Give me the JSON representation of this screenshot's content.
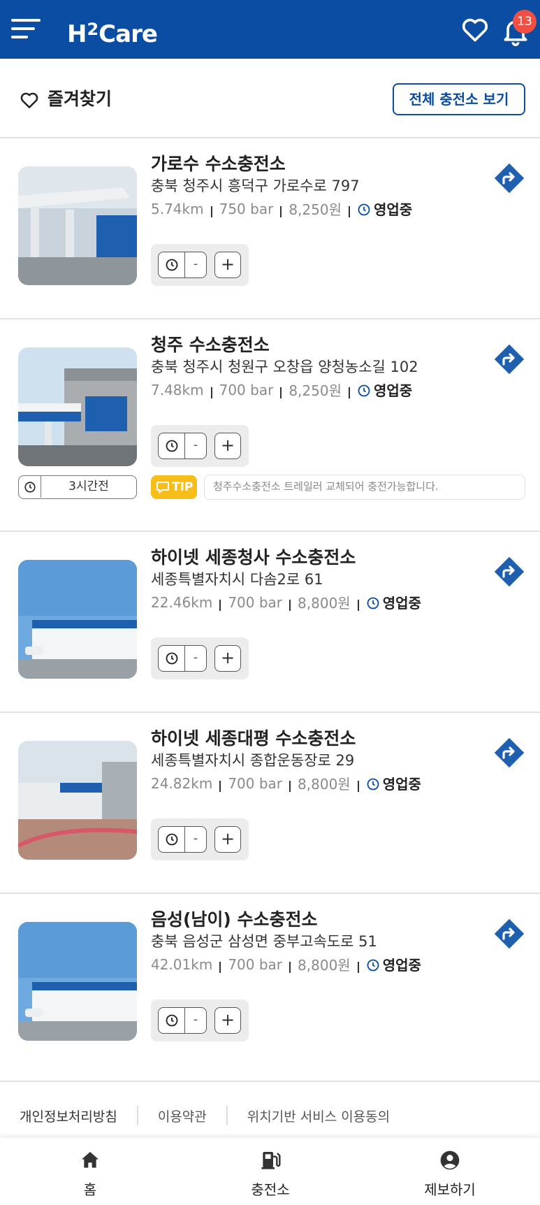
{
  "header": {
    "logo_text": "H2Care",
    "notification_count": "13",
    "brand_color": "#0b4da2"
  },
  "favorites": {
    "title": "즐겨찾기",
    "view_all_label": "전체 충전소 보기"
  },
  "stations": [
    {
      "name": "가로수 수소충전소",
      "address": "충북 청주시 흥덕구 가로수로 797",
      "distance": "5.74km",
      "pressure": "750 bar",
      "price": "8,250원",
      "status": "영업중",
      "stepper_value": "-"
    },
    {
      "name": "청주 수소충전소",
      "address": "충북 청주시 청원구 오창읍 양청농소길 102",
      "distance": "7.48km",
      "pressure": "700 bar",
      "price": "8,250원",
      "status": "영업중",
      "stepper_value": "-",
      "updated": "3시간전",
      "tip_label": "TIP",
      "tip_text": "청주수소충전소 트레일러 교체되어 충전가능합니다."
    },
    {
      "name": "하이넷 세종청사 수소충전소",
      "address": "세종특별자치시 다솜2로 61",
      "distance": "22.46km",
      "pressure": "700 bar",
      "price": "8,800원",
      "status": "영업중",
      "stepper_value": "-"
    },
    {
      "name": "하이넷 세종대평 수소충전소",
      "address": "세종특별자치시 종합운동장로 29",
      "distance": "24.82km",
      "pressure": "700 bar",
      "price": "8,800원",
      "status": "영업중",
      "stepper_value": "-"
    },
    {
      "name": "음성(남이) 수소충전소",
      "address": "충북 음성군 삼성면 중부고속도로 51",
      "distance": "42.01km",
      "pressure": "700 bar",
      "price": "8,800원",
      "status": "영업중",
      "stepper_value": "-"
    }
  ],
  "footer": {
    "privacy": "개인정보처리방침",
    "terms": "이용약관",
    "location": "위치기반 서비스 이용동의"
  },
  "bottom_nav": {
    "home": "홈",
    "stations": "충전소",
    "report": "제보하기"
  },
  "icons": [
    "menu-icon",
    "heart-icon",
    "bell-icon",
    "directions-icon",
    "clock-icon",
    "plus-icon",
    "chat-bubble-icon",
    "home-icon",
    "fuel-pump-icon",
    "user-circle-icon"
  ]
}
